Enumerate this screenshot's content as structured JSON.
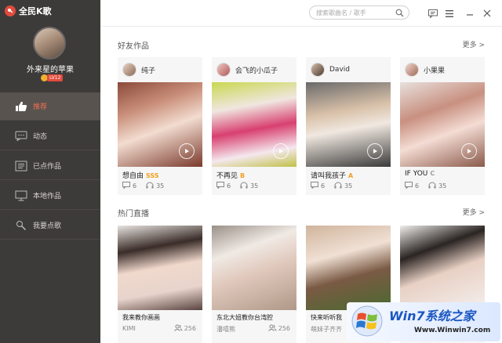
{
  "app": {
    "name": "全民K歌",
    "brand_color": "#e24b3c"
  },
  "sidebar": {
    "username": "外来星的苹果",
    "level_badge": "LV12",
    "items": [
      {
        "label": "推荐",
        "icon": "thumbs-up-icon",
        "active": true
      },
      {
        "label": "动态",
        "icon": "chat-bubble-icon",
        "active": false
      },
      {
        "label": "已点作品",
        "icon": "list-icon",
        "active": false
      },
      {
        "label": "本地作品",
        "icon": "monitor-icon",
        "active": false
      },
      {
        "label": "我要点歌",
        "icon": "microphone-icon",
        "active": false
      }
    ]
  },
  "topbar": {
    "search_placeholder": "搜索歌曲名 / 歌手"
  },
  "friends": {
    "title": "好友作品",
    "more": "更多 >",
    "cards": [
      {
        "user": "纯子",
        "song": "想自由",
        "grade": "SSS",
        "grade_color": "#f0a020",
        "comments": "6",
        "listens": "35"
      },
      {
        "user": "会飞的小瓜子",
        "song": "不再见",
        "grade": "B",
        "grade_color": "#f0a020",
        "comments": "6",
        "listens": "35"
      },
      {
        "user": "David",
        "song": "请叫我孩子",
        "grade": "A",
        "grade_color": "#f0a020",
        "comments": "6",
        "listens": "35"
      },
      {
        "user": "小果果",
        "song": "IF YOU",
        "grade": "C",
        "grade_color": "#999999",
        "comments": "6",
        "listens": "35"
      }
    ]
  },
  "live": {
    "title": "热门直播",
    "more": "更多 >",
    "cards": [
      {
        "title": "我来教你画画",
        "host": "KIMI",
        "viewers": "256"
      },
      {
        "title": "东北大妞教你台湾腔",
        "host": "潘嘻熊",
        "viewers": "256"
      },
      {
        "title": "快来听听我",
        "host": "萌妹子齐齐",
        "viewers": ""
      },
      {
        "title": "",
        "host": "",
        "viewers": ""
      }
    ]
  },
  "watermark": {
    "title": "Win7系统之家",
    "url": "Www.Winwin7.com"
  }
}
